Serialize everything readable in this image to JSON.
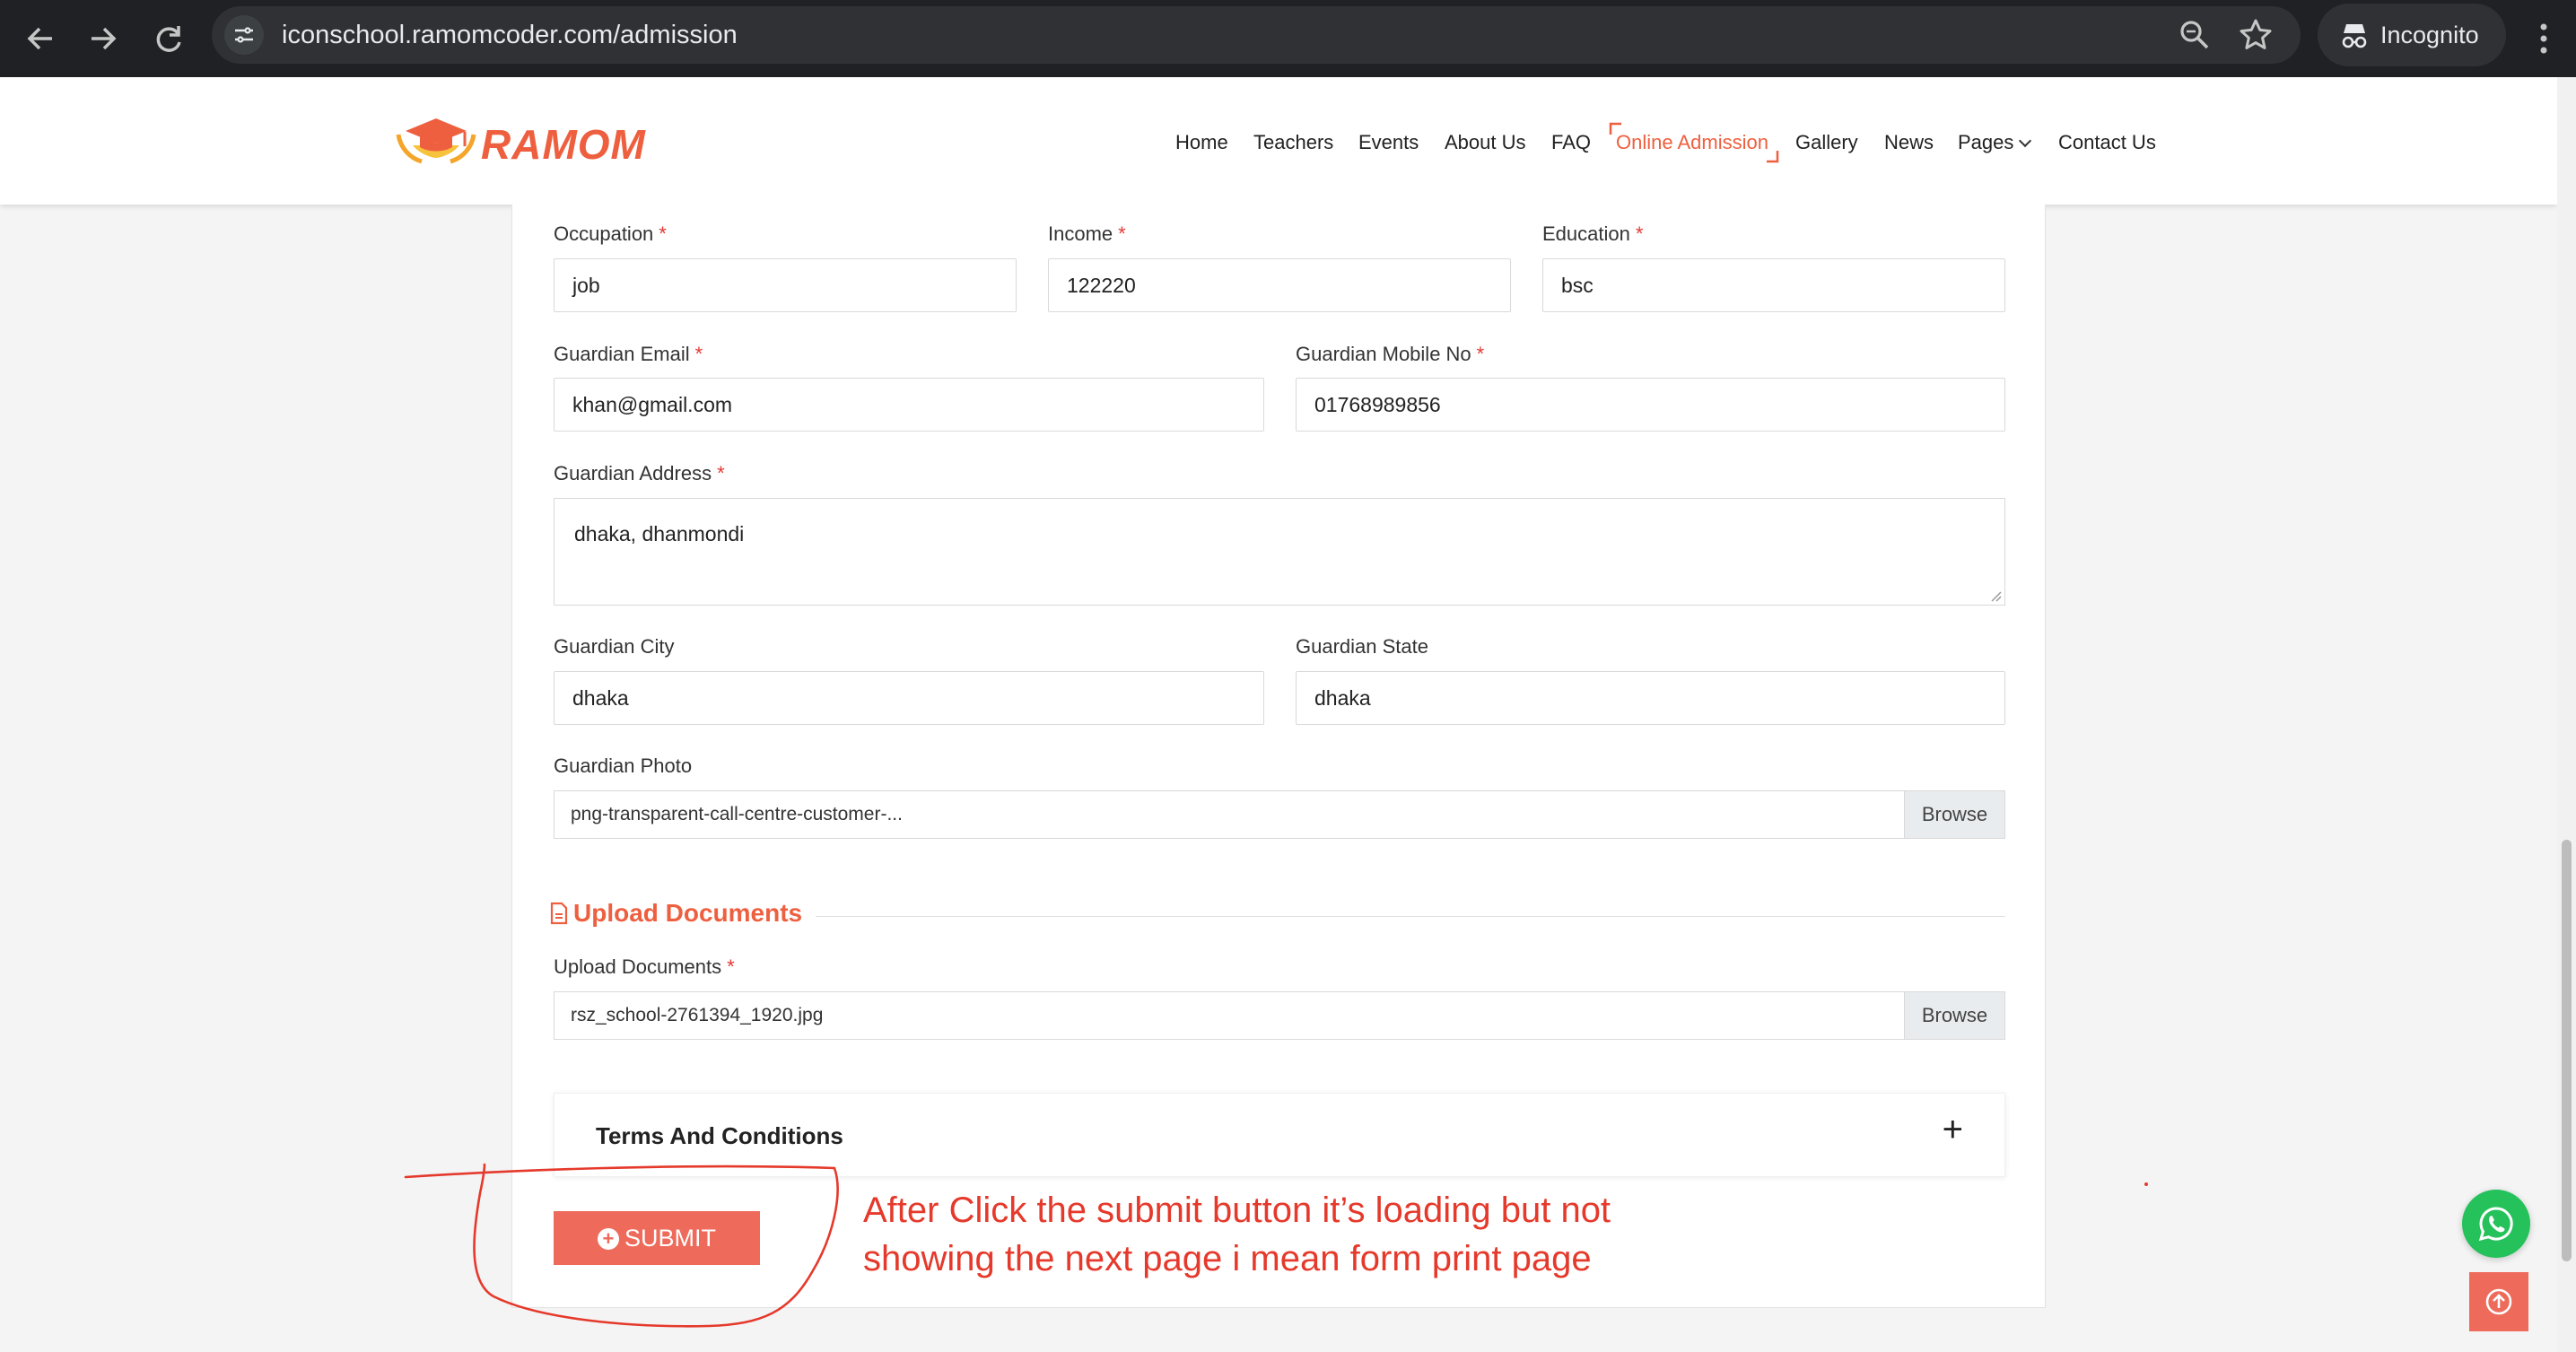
{
  "browser": {
    "url": "iconschool.ramomcoder.com/admission",
    "incognito_label": "Incognito"
  },
  "header": {
    "logo_text": "RAMOM",
    "menu": [
      {
        "label": "Home"
      },
      {
        "label": "Teachers"
      },
      {
        "label": "Events"
      },
      {
        "label": "About Us"
      },
      {
        "label": "FAQ"
      },
      {
        "label": "Online Admission",
        "active": true
      },
      {
        "label": "Gallery"
      },
      {
        "label": "News"
      },
      {
        "label": "Pages"
      },
      {
        "label": "Contact Us"
      }
    ]
  },
  "form": {
    "occupation": {
      "label": "Occupation",
      "value": "job"
    },
    "income": {
      "label": "Income",
      "value": "122220"
    },
    "education": {
      "label": "Education",
      "value": "bsc"
    },
    "guardian_email": {
      "label": "Guardian Email",
      "value": "khan@gmail.com"
    },
    "guardian_mobile": {
      "label": "Guardian Mobile No",
      "value": "01768989856"
    },
    "guardian_address": {
      "label": "Guardian Address",
      "value": "dhaka, dhanmondi"
    },
    "guardian_city": {
      "label": "Guardian City",
      "value": "dhaka"
    },
    "guardian_state": {
      "label": "Guardian State",
      "value": "dhaka"
    },
    "guardian_photo": {
      "label": "Guardian Photo",
      "value": "png-transparent-call-centre-customer-...",
      "browse": "Browse"
    },
    "required_mark": "*"
  },
  "upload_section": {
    "title": "Upload Documents",
    "field_label": "Upload Documents",
    "value": "rsz_school-2761394_1920.jpg",
    "browse": "Browse"
  },
  "terms": {
    "title": "Terms And Conditions",
    "toggle": "+"
  },
  "submit": {
    "label": "SUBMIT"
  },
  "annotation": {
    "line1": "After Click the submit button it’s loading but not",
    "line2": "showing the next page i mean form print page",
    "color": "#e5392b"
  },
  "colors": {
    "accent": "#ee5f3f",
    "button": "#ee6a5a",
    "whatsapp": "#25c15a"
  }
}
